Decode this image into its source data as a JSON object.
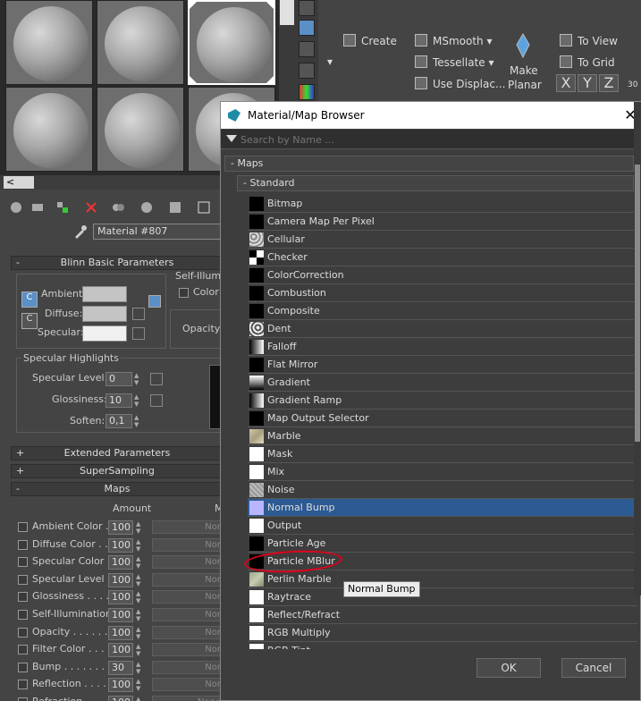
{
  "material_editor": {
    "slot_scroll_label": "<",
    "material_name": "Material #807",
    "rollouts": {
      "blinn_basic": "Blinn Basic Parameters",
      "extended": "Extended Parameters",
      "supersampling": "SuperSampling",
      "maps": "Maps",
      "minus": "-",
      "plus": "+"
    },
    "blinn": {
      "ambient": "Ambient:",
      "diffuse": "Diffuse:",
      "specular": "Specular:",
      "self_illum": "Self-Illumi",
      "color": "Color",
      "opacity": "Opacity:",
      "c_btn": "C"
    },
    "specular_highlights": {
      "title": "Specular Highlights",
      "level_label": "Specular Level:",
      "level_value": "0",
      "gloss_label": "Glossiness:",
      "gloss_value": "10",
      "soften_label": "Soften:",
      "soften_value": "0,1"
    },
    "maps": {
      "amount_header": "Amount",
      "map_header": "M",
      "rows": [
        {
          "label": "Ambient Color . .",
          "value": "100",
          "map": "Nor"
        },
        {
          "label": "Diffuse Color . .",
          "value": "100",
          "map": "Nor"
        },
        {
          "label": "Specular Color",
          "value": "100",
          "map": "Nor"
        },
        {
          "label": "Specular Level .",
          "value": "100",
          "map": "Nor"
        },
        {
          "label": "Glossiness . . . .",
          "value": "100",
          "map": "Nor"
        },
        {
          "label": "Self-Illumination .",
          "value": "100",
          "map": "Nor"
        },
        {
          "label": "Opacity . . . . . .",
          "value": "100",
          "map": "Nor"
        },
        {
          "label": "Filter Color . . .",
          "value": "100",
          "map": "Nor"
        },
        {
          "label": "Bump . . . . . . .",
          "value": "30",
          "map": "Nor"
        },
        {
          "label": "Reflection . . . .",
          "value": "100",
          "map": "Nor"
        },
        {
          "label": "Refraction",
          "value": "100",
          "map": "None"
        }
      ]
    }
  },
  "ribbon": {
    "create": "Create",
    "msmooth": "MSmooth",
    "tessellate": "Tessellate",
    "use_displace": "Use Displac...",
    "make_planar_1": "Make",
    "make_planar_2": "Planar",
    "to_view": "To View",
    "to_grid": "To Grid",
    "axes": [
      "X",
      "Y",
      "Z"
    ],
    "dropdown": "▾",
    "num30": "30"
  },
  "dialog": {
    "title": "Material/Map Browser",
    "close": "✕",
    "search_placeholder": "Search by Name ...",
    "group_maps": "- Maps",
    "group_standard": "- Standard",
    "items": [
      "Bitmap",
      "Camera Map Per Pixel",
      "Cellular",
      "Checker",
      "ColorCorrection",
      "Combustion",
      "Composite",
      "Dent",
      "Falloff",
      "Flat Mirror",
      "Gradient",
      "Gradient Ramp",
      "Map Output Selector",
      "Marble",
      "Mask",
      "Mix",
      "Noise",
      "Normal Bump",
      "Output",
      "Particle Age",
      "Particle MBlur",
      "Perlin Marble",
      "Raytrace",
      "Reflect/Refract",
      "RGB Multiply",
      "RGB Tint"
    ],
    "selected_item": "Normal Bump",
    "tooltip": "Normal Bump",
    "ok": "OK",
    "cancel": "Cancel"
  }
}
